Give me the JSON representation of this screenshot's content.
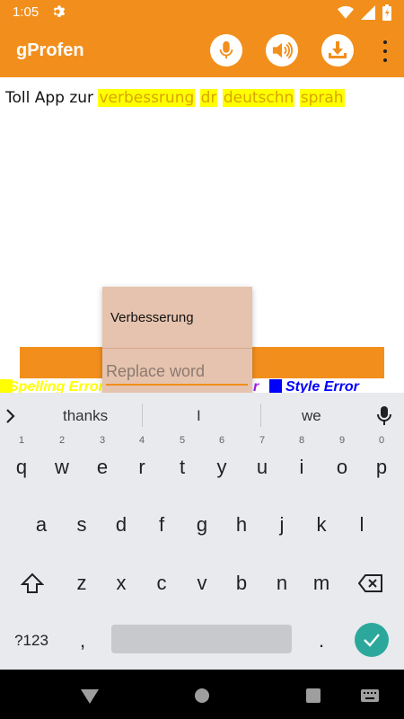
{
  "status": {
    "time": "1:05"
  },
  "app": {
    "title": "gProfen"
  },
  "content": {
    "prefix": "Toll App zur ",
    "highlighted_words": [
      "verbessrung",
      "dr",
      "deutschn",
      "sprah"
    ]
  },
  "legend": {
    "spelling": "Spelling Error",
    "grammar": "r",
    "style": "Style Error"
  },
  "popup": {
    "title": "Verbesserung",
    "input_placeholder": "Replace word",
    "input_value": ""
  },
  "keyboard": {
    "suggestions": [
      "thanks",
      "I",
      "we"
    ],
    "row1": [
      {
        "k": "q",
        "n": "1"
      },
      {
        "k": "w",
        "n": "2"
      },
      {
        "k": "e",
        "n": "3"
      },
      {
        "k": "r",
        "n": "4"
      },
      {
        "k": "t",
        "n": "5"
      },
      {
        "k": "y",
        "n": "6"
      },
      {
        "k": "u",
        "n": "7"
      },
      {
        "k": "i",
        "n": "8"
      },
      {
        "k": "o",
        "n": "9"
      },
      {
        "k": "p",
        "n": "0"
      }
    ],
    "row2": [
      "a",
      "s",
      "d",
      "f",
      "g",
      "h",
      "j",
      "k",
      "l"
    ],
    "row3": [
      "z",
      "x",
      "c",
      "v",
      "b",
      "n",
      "m"
    ],
    "symbols_label": "?123",
    "comma": ",",
    "period": "."
  },
  "colors": {
    "accent": "#F28F1C",
    "highlight": "#FFFF00",
    "popup_bg": "#E6C3AE",
    "enter": "#2BA89B",
    "style_error": "#0000FF",
    "spelling_error": "#FFFF00",
    "grammar_error": "#A020F0"
  }
}
